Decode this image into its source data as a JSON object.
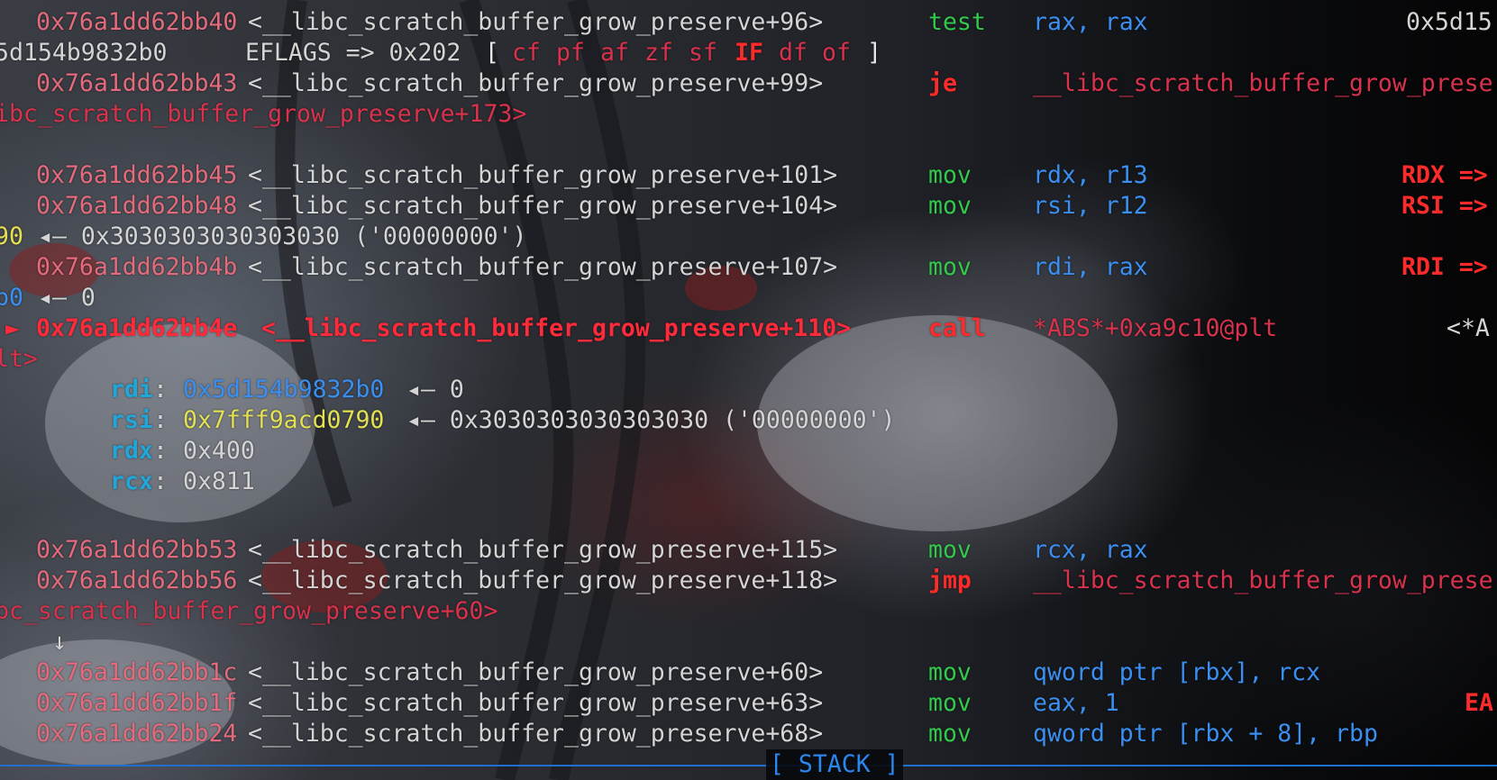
{
  "lines": [
    {
      "address": "0x76a1dd62bb40",
      "symbol": "<__libc_scratch_buffer_grow_preserve+96>",
      "mnemonic": "test",
      "operands": "rax, rax",
      "note": "0x5d15"
    },
    {
      "cont_addr": "5d154b9832b0",
      "label": "EFLAGS => 0x202",
      "flags": [
        "cf",
        "pf",
        "af",
        "zf",
        "sf",
        "IF",
        "df",
        "of"
      ],
      "set_flags": [
        "IF"
      ]
    },
    {
      "address": "0x76a1dd62bb43",
      "symbol": "<__libc_scratch_buffer_grow_preserve+99>",
      "mnemonic": "je",
      "operands": "__libc_scratch_buffer_grow_prese"
    },
    {
      "wrap": "ibc_scratch_buffer_grow_preserve+173>"
    },
    {
      "address": "0x76a1dd62bb45",
      "symbol": "<__libc_scratch_buffer_grow_preserve+101>",
      "mnemonic": "mov",
      "operands": "rdx, r13",
      "note": "RDX =>"
    },
    {
      "address": "0x76a1dd62bb48",
      "symbol": "<__libc_scratch_buffer_grow_preserve+104>",
      "mnemonic": "mov",
      "operands": "rsi, r12",
      "note": "RSI =>"
    },
    {
      "wrap_prefix": "90",
      "wrap": "◂— 0x3030303030303030 ('00000000')"
    },
    {
      "address": "0x76a1dd62bb4b",
      "symbol": "<__libc_scratch_buffer_grow_preserve+107>",
      "mnemonic": "mov",
      "operands": "rdi, rax",
      "note": "RDI =>"
    },
    {
      "wrap_prefix": "b0",
      "wrap": "◂— 0"
    },
    {
      "marker": "►",
      "address": "0x76a1dd62bb4e",
      "symbol": "<__libc_scratch_buffer_grow_preserve+110>",
      "mnemonic": "call",
      "operands": "*ABS*+0xa9c10@plt",
      "note": "<*A"
    },
    {
      "wrap": "lt>"
    },
    {
      "args": [
        {
          "reg": "rdi",
          "value": "0x5d154b9832b0",
          "deref": "◂— 0"
        },
        {
          "reg": "rsi",
          "value": "0x7fff9acd0790",
          "deref": "◂— 0x3030303030303030 ('00000000')"
        },
        {
          "reg": "rdx",
          "value": "0x400"
        },
        {
          "reg": "rcx",
          "value": "0x811"
        }
      ]
    },
    {
      "address": "0x76a1dd62bb53",
      "symbol": "<__libc_scratch_buffer_grow_preserve+115>",
      "mnemonic": "mov",
      "operands": "rcx, rax"
    },
    {
      "address": "0x76a1dd62bb56",
      "symbol": "<__libc_scratch_buffer_grow_preserve+118>",
      "mnemonic": "jmp",
      "operands": "__libc_scratch_buffer_grow_prese"
    },
    {
      "wrap": "bc_scratch_buffer_grow_preserve+60>"
    },
    {
      "down_arrow": "↓"
    },
    {
      "address": "0x76a1dd62bb1c",
      "symbol": "<__libc_scratch_buffer_grow_preserve+60>",
      "mnemonic": "mov",
      "operands": "qword ptr [rbx], rcx"
    },
    {
      "address": "0x76a1dd62bb1f",
      "symbol": "<__libc_scratch_buffer_grow_preserve+63>",
      "mnemonic": "mov",
      "operands": "eax, 1",
      "note": "EA"
    },
    {
      "address": "0x76a1dd62bb24",
      "symbol": "<__libc_scratch_buffer_grow_preserve+68>",
      "mnemonic": "mov",
      "operands": "qword ptr [rbx + 8], rbp"
    }
  ],
  "stack_header": "[ STACK ]",
  "colors": {
    "address": "#e36b7c",
    "current": "#ff2a3a",
    "mnemonic_mov": "#33c94d",
    "mnemonic_branch": "#ff2b2b",
    "register": "#3a8ff0",
    "pointer_yellow": "#e3e051",
    "arg_register": "#22a6d8",
    "rule": "#1f6fd1"
  }
}
